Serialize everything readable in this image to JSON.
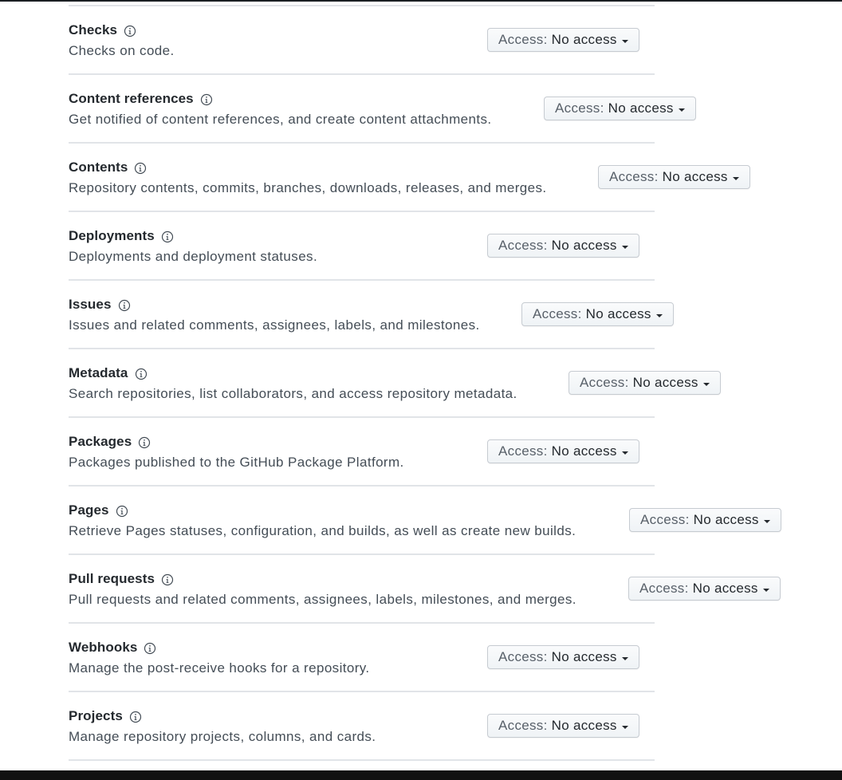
{
  "permissions": [
    {
      "name": "Checks",
      "description": "Checks on code.",
      "access_label": "Access:",
      "access_value": "No access"
    },
    {
      "name": "Content references",
      "description": "Get notified of content references, and create content attachments.",
      "access_label": "Access:",
      "access_value": "No access"
    },
    {
      "name": "Contents",
      "description": "Repository contents, commits, branches, downloads, releases, and merges.",
      "access_label": "Access:",
      "access_value": "No access"
    },
    {
      "name": "Deployments",
      "description": "Deployments and deployment statuses.",
      "access_label": "Access:",
      "access_value": "No access"
    },
    {
      "name": "Issues",
      "description": "Issues and related comments, assignees, labels, and milestones.",
      "access_label": "Access:",
      "access_value": "No access"
    },
    {
      "name": "Metadata",
      "description": "Search repositories, list collaborators, and access repository metadata.",
      "access_label": "Access:",
      "access_value": "No access"
    },
    {
      "name": "Packages",
      "description": "Packages published to the GitHub Package Platform.",
      "access_label": "Access:",
      "access_value": "No access"
    },
    {
      "name": "Pages",
      "description": "Retrieve Pages statuses, configuration, and builds, as well as create new builds.",
      "access_label": "Access:",
      "access_value": "No access"
    },
    {
      "name": "Pull requests",
      "description": "Pull requests and related comments, assignees, labels, milestones, and merges.",
      "access_label": "Access:",
      "access_value": "No access"
    },
    {
      "name": "Webhooks",
      "description": "Manage the post-receive hooks for a repository.",
      "access_label": "Access:",
      "access_value": "No access"
    },
    {
      "name": "Projects",
      "description": "Manage repository projects, columns, and cards.",
      "access_label": "Access:",
      "access_value": "No access"
    }
  ],
  "icons": {
    "info": "info-icon",
    "dropdown": "caret-down-icon"
  },
  "colors": {
    "divider": "#e1e4e8",
    "text": "#24292e",
    "muted": "#586069"
  }
}
